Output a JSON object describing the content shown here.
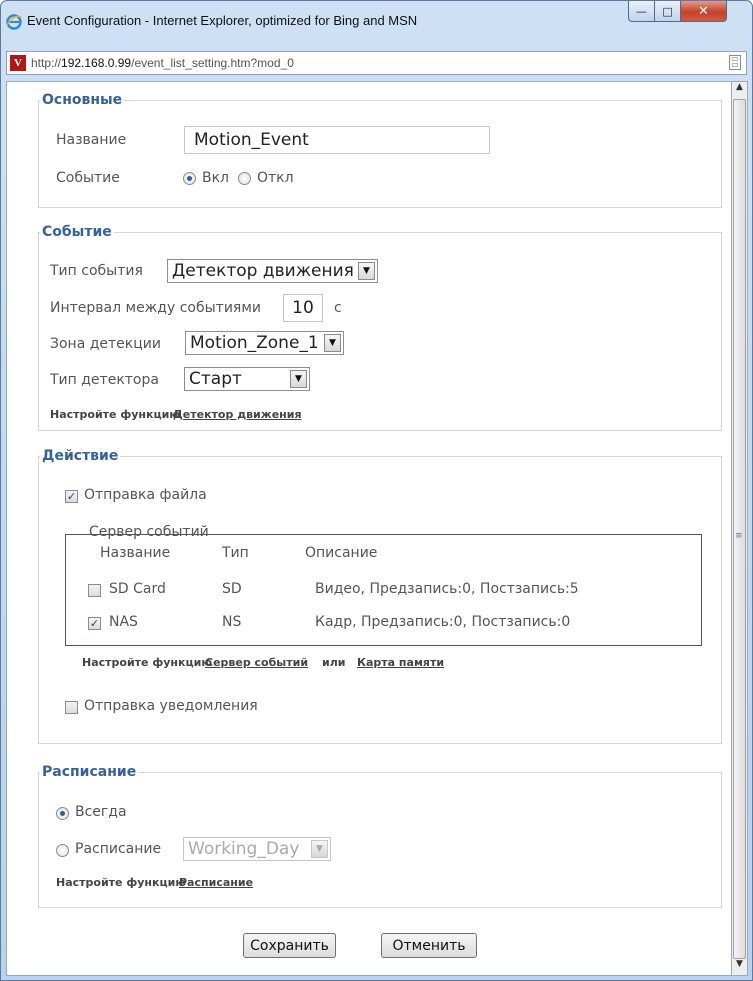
{
  "window": {
    "title": "Event Configuration - Internet Explorer, optimized for Bing and MSN",
    "url_prefix": "http://",
    "url_host": "192.168.0.99",
    "url_path": "/event_list_setting.htm?mod_0",
    "controls": {
      "minimize": "—",
      "maximize": "□",
      "close": "✕"
    }
  },
  "basic": {
    "legend": "Основные",
    "name_label": "Название",
    "name_value": "Motion_Event",
    "event_label": "Событие",
    "on_label": "Вкл",
    "off_label": "Откл",
    "state": "on"
  },
  "event": {
    "legend": "Событие",
    "type_label": "Тип события",
    "type_value": "Детектор движения",
    "interval_label": "Интервал между событиями",
    "interval_value": "10",
    "interval_unit": "с",
    "zone_label": "Зона детекции",
    "zone_value": "Motion_Zone_1",
    "detector_label": "Тип детектора",
    "detector_value": "Старт",
    "configure_label": "Настройте функцию",
    "configure_link": "Детектор движения"
  },
  "action": {
    "legend": "Действие",
    "send_file_label": "Отправка файла",
    "send_file_checked": true,
    "server_label": "Сервер событий",
    "columns": [
      "Название",
      "Тип",
      "Описание"
    ],
    "rows": [
      {
        "name": "SD Card",
        "type": "SD",
        "description": "Видео, Предзапись:0, Постзапись:5",
        "checked": false
      },
      {
        "name": "NAS",
        "type": "NS",
        "description": "Кадр, Предзапись:0, Постзапись:0",
        "checked": true
      }
    ],
    "configure_label": "Настройте функцию",
    "link_server": "Сервер событий",
    "or_label": "или",
    "link_memory": "Карта памяти",
    "notify_label": "Отправка уведомления",
    "notify_checked": false
  },
  "schedule": {
    "legend": "Расписание",
    "always_label": "Всегда",
    "schedule_label": "Расписание",
    "schedule_value": "Working_Day",
    "selected": "always",
    "configure_label": "Настройте функцию",
    "configure_link": "Расписание"
  },
  "buttons": {
    "save": "Сохранить",
    "cancel": "Отменить"
  }
}
